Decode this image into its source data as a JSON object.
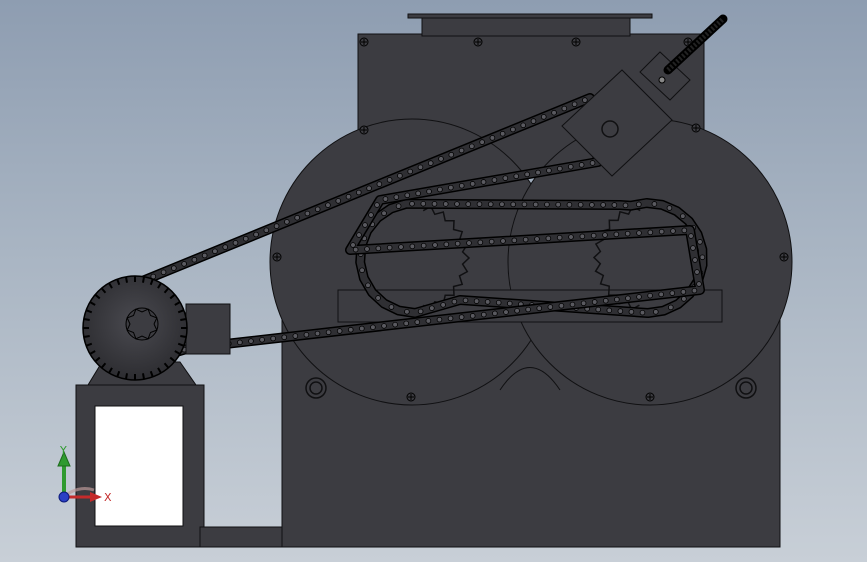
{
  "viewport": {
    "background_top": "#8e9db1",
    "background_bottom": "#c8cfd7"
  },
  "model": {
    "body_color": "#3c3c41",
    "edge_color": "#101012",
    "chain_link_color": "#5a5a60"
  },
  "triad": {
    "x_label": "X",
    "y_label": "Y",
    "x_color": "#c42b2b",
    "y_color": "#2f9a2f",
    "z_color": "#2b3fc4"
  }
}
